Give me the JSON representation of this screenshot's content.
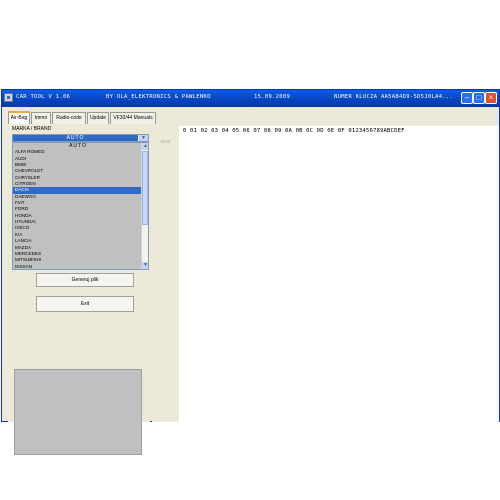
{
  "window": {
    "title_app": "CAR TOOL V 1.06",
    "title_author": "BY OLA_ELEKTRONICS & PAWLENKO",
    "title_date": "15.09.2009",
    "title_key": "NUMER KLUCZA AA5AB4D9-5D5J0LA4..."
  },
  "tabs": [
    "Air-Bag",
    "Immo",
    "Radio-code",
    "Update",
    "VF30/44 Manuals"
  ],
  "brand_section": {
    "label": "MARKA / BRAND",
    "selected_value": "AUTO",
    "list_header": "AUTO",
    "items": [
      "ALFA ROMEO",
      "AUDI",
      "BMW",
      "CHEVROLET",
      "CHRYSLER",
      "CITROEN",
      "DACIA",
      "DAEWOO",
      "FIAT",
      "FORD",
      "HONDA",
      "HYUNDAI",
      "IVECO",
      "KIA",
      "LANCIA",
      "MAZDA",
      "MERCEDES",
      "MITSUBISHI",
      "NISSAN"
    ],
    "selected_item": "DACIA"
  },
  "buttons": {
    "generate": "Generuj plik",
    "exit": "Exit"
  },
  "hex_view": {
    "offset_label": "0x00",
    "header": "0 01 02 03 04 05 06 07 08 09 0A 0B 0C 0D 0E 0F  0123456789ABCDEF"
  },
  "icons": {
    "minimize": "minimize-icon",
    "maximize": "maximize-icon",
    "close": "close-icon",
    "dropdown": "chevron-down-icon"
  }
}
